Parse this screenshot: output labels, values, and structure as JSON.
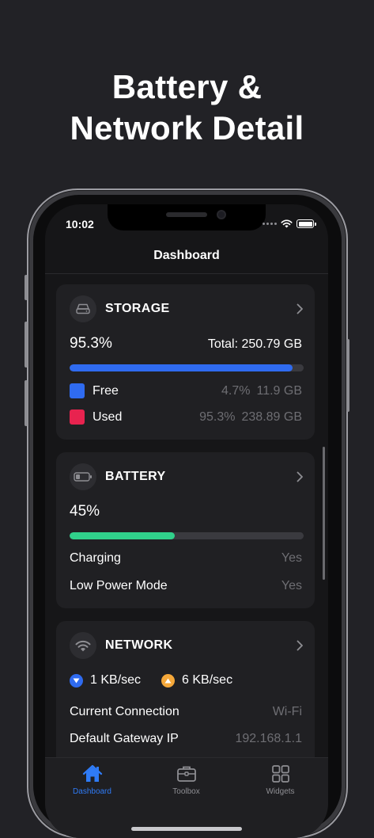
{
  "promo": {
    "title": "Battery &\nNetwork Detail"
  },
  "status_bar": {
    "time": "10:02"
  },
  "nav": {
    "title": "Dashboard"
  },
  "storage": {
    "title": "STORAGE",
    "icon": "hard-drive-icon",
    "used_percent_label": "95.3%",
    "total_label": "Total: 250.79 GB",
    "used_fraction": 0.953,
    "bar_color": "#2f6bf0",
    "free": {
      "label": "Free",
      "percent": "4.7%",
      "size": "11.9 GB",
      "color": "#2f6bf0"
    },
    "used": {
      "label": "Used",
      "percent": "95.3%",
      "size": "238.89 GB",
      "color": "#e8234f"
    }
  },
  "battery": {
    "title": "BATTERY",
    "icon": "battery-icon",
    "level_label": "45%",
    "level_fraction": 0.45,
    "bar_color": "#30d18b",
    "charging": {
      "label": "Charging",
      "value": "Yes"
    },
    "low_power": {
      "label": "Low Power Mode",
      "value": "Yes"
    }
  },
  "network": {
    "title": "NETWORK",
    "icon": "wifi-icon",
    "download": {
      "value": "1 KB/sec",
      "color": "#2f6bf0"
    },
    "upload": {
      "value": "6 KB/sec",
      "color": "#f5a83a"
    },
    "connection": {
      "label": "Current Connection",
      "value": "Wi-Fi"
    },
    "gateway": {
      "label": "Default Gateway IP",
      "value": "192.168.1.1"
    }
  },
  "tabs": [
    {
      "label": "Dashboard",
      "icon": "house-icon",
      "active": true
    },
    {
      "label": "Toolbox",
      "icon": "toolbox-icon",
      "active": false
    },
    {
      "label": "Widgets",
      "icon": "grid-icon",
      "active": false
    }
  ],
  "colors": {
    "accent": "#2f7bf6",
    "inactive": "#8e8e93"
  }
}
